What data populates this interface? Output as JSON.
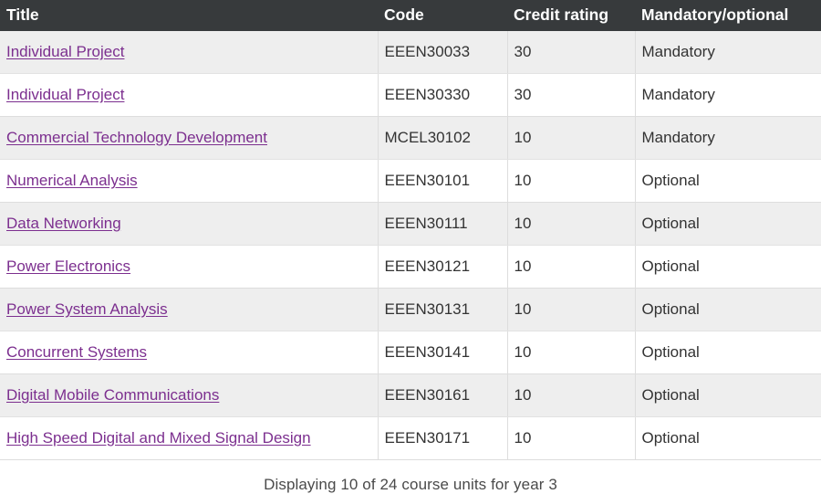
{
  "table": {
    "columns": [
      {
        "key": "title",
        "label": "Title"
      },
      {
        "key": "code",
        "label": "Code"
      },
      {
        "key": "credit",
        "label": "Credit rating"
      },
      {
        "key": "status",
        "label": "Mandatory/optional"
      }
    ],
    "rows": [
      {
        "title": "Individual Project",
        "code": "EEEN30033",
        "credit": "30",
        "status": "Mandatory"
      },
      {
        "title": "Individual Project",
        "code": "EEEN30330",
        "credit": "30",
        "status": "Mandatory"
      },
      {
        "title": "Commercial Technology Development",
        "code": "MCEL30102",
        "credit": "10",
        "status": "Mandatory"
      },
      {
        "title": "Numerical Analysis",
        "code": "EEEN30101",
        "credit": "10",
        "status": "Optional"
      },
      {
        "title": "Data Networking",
        "code": "EEEN30111",
        "credit": "10",
        "status": "Optional"
      },
      {
        "title": "Power Electronics",
        "code": "EEEN30121",
        "credit": "10",
        "status": "Optional"
      },
      {
        "title": "Power System Analysis",
        "code": "EEEN30131",
        "credit": "10",
        "status": "Optional"
      },
      {
        "title": "Concurrent Systems",
        "code": "EEEN30141",
        "credit": "10",
        "status": "Optional"
      },
      {
        "title": "Digital Mobile Communications",
        "code": "EEEN30161",
        "credit": "10",
        "status": "Optional"
      },
      {
        "title": "High Speed Digital and Mixed Signal Design",
        "code": "EEEN30171",
        "credit": "10",
        "status": "Optional"
      }
    ],
    "caption": "Displaying 10 of 24 course units for year 3"
  },
  "colors": {
    "header_background": "#373a3c",
    "header_text": "#ffffff",
    "row_alt_background": "#eeeeee",
    "row_background": "#ffffff",
    "link": "#7c2f8f",
    "body_text": "#333333",
    "border": "#dddddd"
  }
}
